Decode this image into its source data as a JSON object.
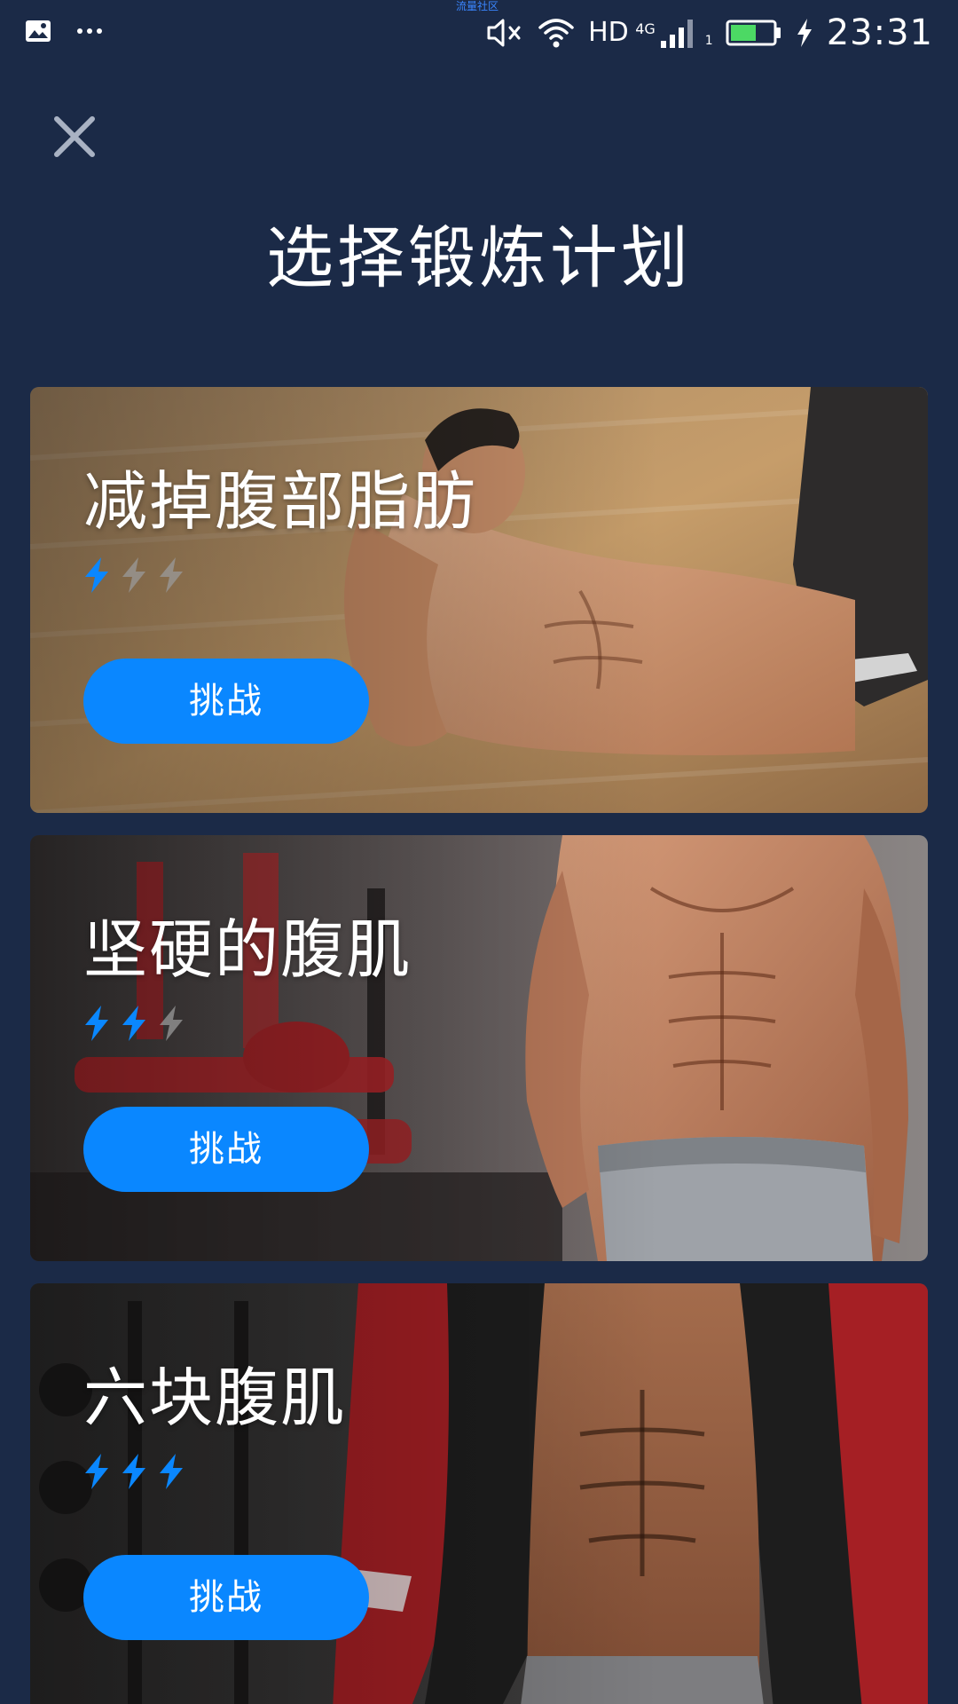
{
  "status_bar": {
    "watermark": "流量社区",
    "network": "HD",
    "network_gen": "4G",
    "sim_slot": "1",
    "battery_level": 0.6,
    "time": "23:31",
    "icons": [
      "image-icon",
      "more-dots-icon",
      "mute-icon",
      "wifi-icon",
      "signal-icon",
      "battery-icon",
      "charging-icon"
    ]
  },
  "header": {
    "close_icon": "close-icon",
    "title": "选择锻炼计划"
  },
  "plans": [
    {
      "title": "减掉腹部脂肪",
      "level": 1,
      "level_max": 3,
      "button": "挑战"
    },
    {
      "title": "坚硬的腹肌",
      "level": 2,
      "level_max": 3,
      "button": "挑战"
    },
    {
      "title": "六块腹肌",
      "level": 3,
      "level_max": 3,
      "button": "挑战"
    }
  ],
  "colors": {
    "background": "#1b2a47",
    "accent": "#0a87ff",
    "level_active": "#0a87ff",
    "level_inactive": "#9a9a9a"
  }
}
